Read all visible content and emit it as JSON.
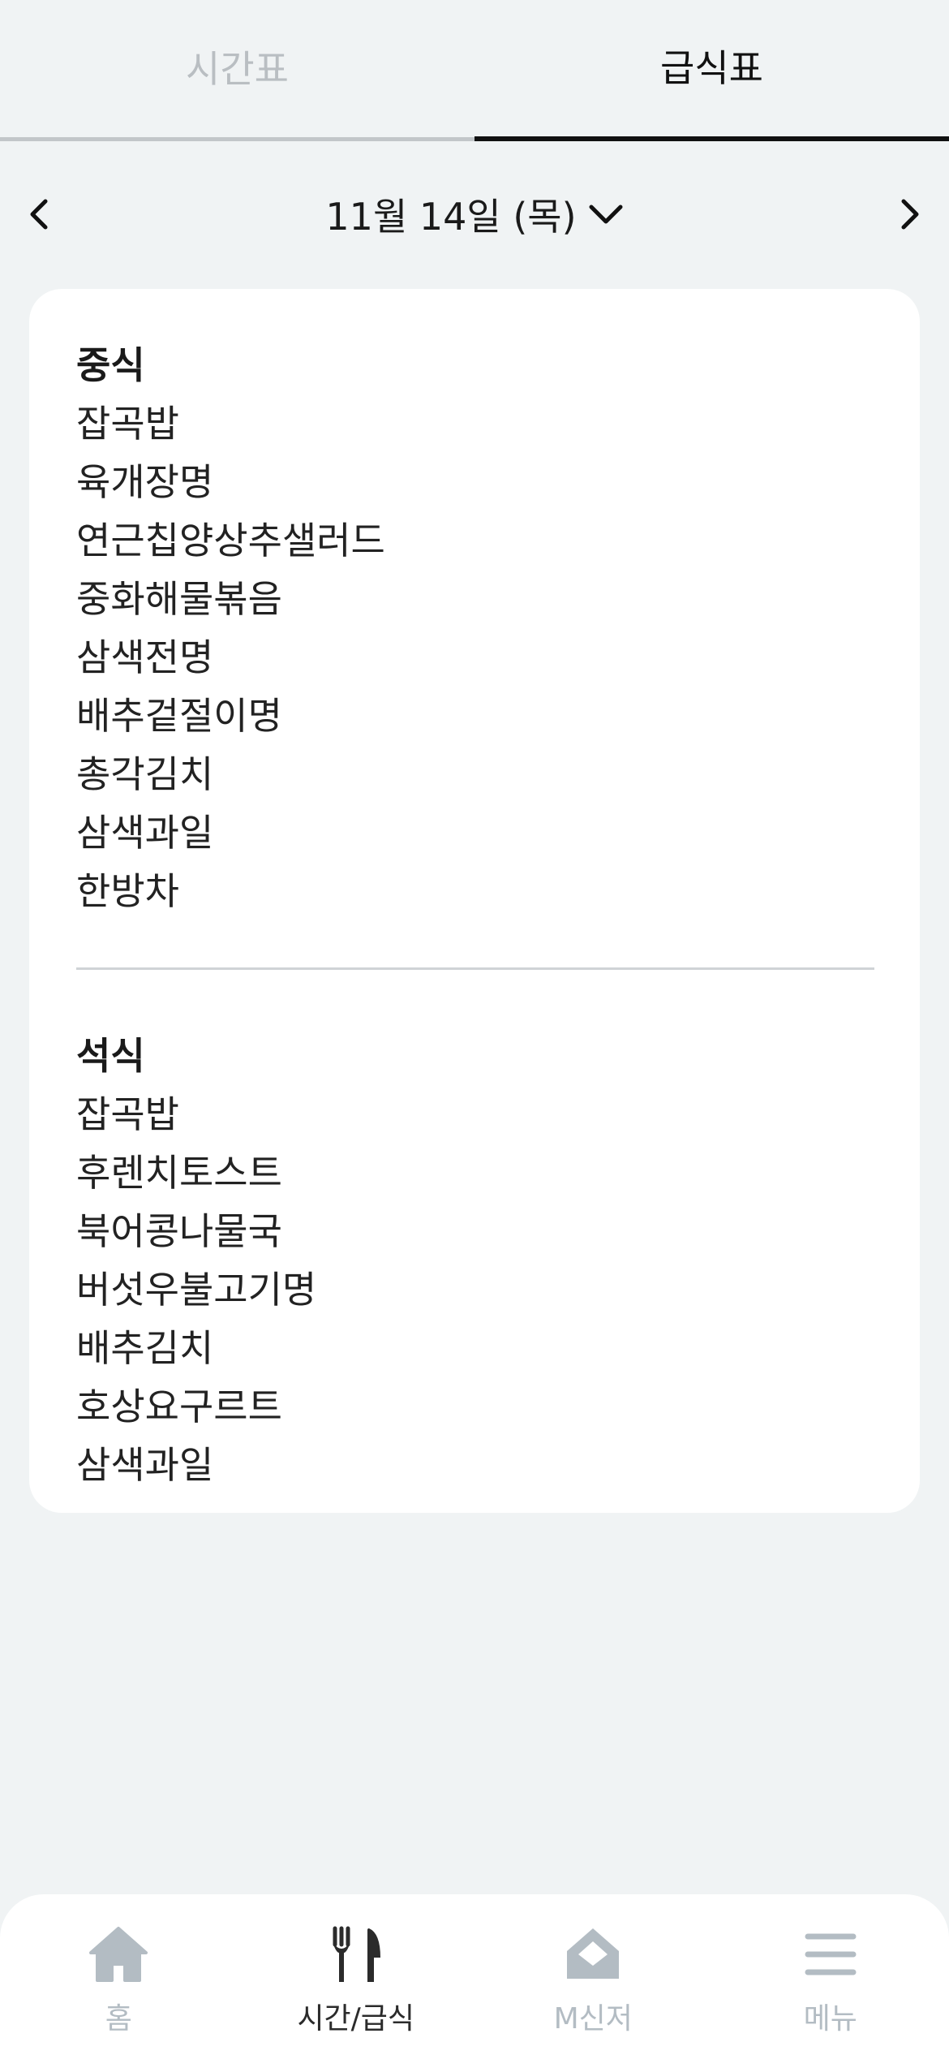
{
  "tabs": [
    {
      "label": "시간표",
      "active": false
    },
    {
      "label": "급식표",
      "active": true
    }
  ],
  "date": {
    "label": "11월 14일 (목)"
  },
  "meals": {
    "lunch": {
      "title": "중식",
      "items": [
        "잡곡밥",
        "육개장명",
        "연근칩양상추샐러드",
        "중화해물볶음",
        "삼색전명",
        "배추겉절이명",
        "총각김치",
        "삼색과일",
        "한방차"
      ]
    },
    "dinner": {
      "title": "석식",
      "items": [
        "잡곡밥",
        "후렌치토스트",
        "북어콩나물국",
        "버섯우불고기명",
        "배추김치",
        "호상요구르트",
        "삼색과일"
      ]
    }
  },
  "bottom_nav": {
    "items": [
      {
        "label": "홈",
        "icon": "home-icon",
        "active": false
      },
      {
        "label": "시간/급식",
        "icon": "fork-knife-icon",
        "active": true
      },
      {
        "label": "M신저",
        "icon": "envelope-icon",
        "active": false
      },
      {
        "label": "메뉴",
        "icon": "hamburger-menu-icon",
        "active": false
      }
    ]
  },
  "colors": {
    "background": "#f0f3f4",
    "active": "#111111",
    "inactive": "#b3bcc3"
  }
}
